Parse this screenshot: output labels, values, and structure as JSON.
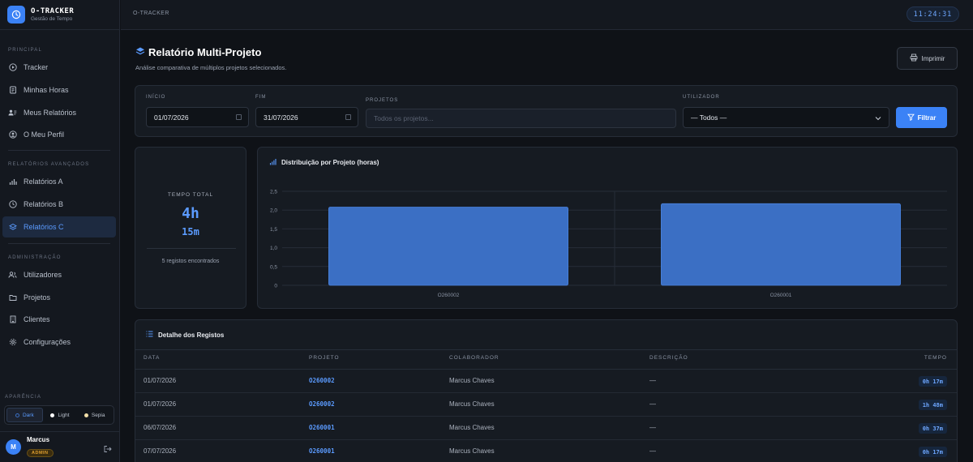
{
  "app": {
    "title": "O-TRACKER",
    "subtitle": "Gestão de Tempo"
  },
  "topbar": {
    "breadcrumb": "O-TRACKER",
    "clock": "11:24:31"
  },
  "sidebar": {
    "sections": [
      {
        "label": "PRINCIPAL",
        "items": [
          {
            "label": "Tracker",
            "icon": "play-circle-icon"
          },
          {
            "label": "Minhas Horas",
            "icon": "document-icon"
          },
          {
            "label": "Meus Relatórios",
            "icon": "user-report-icon"
          },
          {
            "label": "O Meu Perfil",
            "icon": "user-circle-icon"
          }
        ]
      },
      {
        "label": "RELATÓRIOS AVANÇADOS",
        "items": [
          {
            "label": "Relatórios A",
            "icon": "bar-chart-icon"
          },
          {
            "label": "Relatórios B",
            "icon": "clock-icon"
          },
          {
            "label": "Relatórios C",
            "icon": "layers-icon",
            "active": true
          }
        ]
      },
      {
        "label": "ADMINISTRAÇÃO",
        "items": [
          {
            "label": "Utilizadores",
            "icon": "users-icon"
          },
          {
            "label": "Projetos",
            "icon": "folder-icon"
          },
          {
            "label": "Clientes",
            "icon": "building-icon"
          },
          {
            "label": "Configurações",
            "icon": "gear-icon"
          }
        ]
      }
    ],
    "appearance": {
      "label": "APARÊNCIA",
      "options": [
        {
          "label": "Dark",
          "selected": true
        },
        {
          "label": "Light"
        },
        {
          "label": "Sepia"
        }
      ]
    },
    "user": {
      "initial": "M",
      "name": "Marcus",
      "role": "ADMIN"
    }
  },
  "page": {
    "title": "Relatório Multi-Projeto",
    "subtitle": "Análise comparativa de múltiplos projetos selecionados.",
    "print_label": "Imprimir"
  },
  "filters": {
    "start_label": "INÍCIO",
    "start_value": "01/07/2026",
    "end_label": "FIM",
    "end_value": "31/07/2026",
    "projects_label": "PROJETOS",
    "projects_placeholder": "Todos os projetos...",
    "user_label": "UTILIZADOR",
    "user_value": "— Todos —",
    "filter_label": "Filtrar"
  },
  "summary": {
    "label": "TEMPO TOTAL",
    "hours": "4h",
    "minutes": "15m",
    "count_text": "5 registos encontrados"
  },
  "chart_data": {
    "type": "bar",
    "title": "Distribuição por Projeto (horas)",
    "categories": [
      "O260002",
      "O260001"
    ],
    "values": [
      2.08,
      2.17
    ],
    "ylim": [
      0,
      2.5
    ],
    "yticks": [
      "0",
      "0,5",
      "1,0",
      "1,5",
      "2,0",
      "2,5"
    ],
    "grid": true,
    "bar_color": "#3b6fc4"
  },
  "table": {
    "title": "Detalhe dos Registos",
    "columns": [
      "DATA",
      "PROJETO",
      "COLABORADOR",
      "DESCRIÇÃO",
      "TEMPO"
    ],
    "rows": [
      {
        "date": "01/07/2026",
        "project": "O260002",
        "user": "Marcus Chaves",
        "desc": "—",
        "time": "0h 17m"
      },
      {
        "date": "01/07/2026",
        "project": "O260002",
        "user": "Marcus Chaves",
        "desc": "—",
        "time": "1h 48m"
      },
      {
        "date": "06/07/2026",
        "project": "O260001",
        "user": "Marcus Chaves",
        "desc": "—",
        "time": "0h 37m"
      },
      {
        "date": "07/07/2026",
        "project": "O260001",
        "user": "Marcus Chaves",
        "desc": "—",
        "time": "0h 17m"
      }
    ]
  },
  "colors": {
    "accent": "#3b82f6",
    "background": "#0f1217",
    "panel": "#161b22",
    "admin_badge": "#e0a030"
  }
}
